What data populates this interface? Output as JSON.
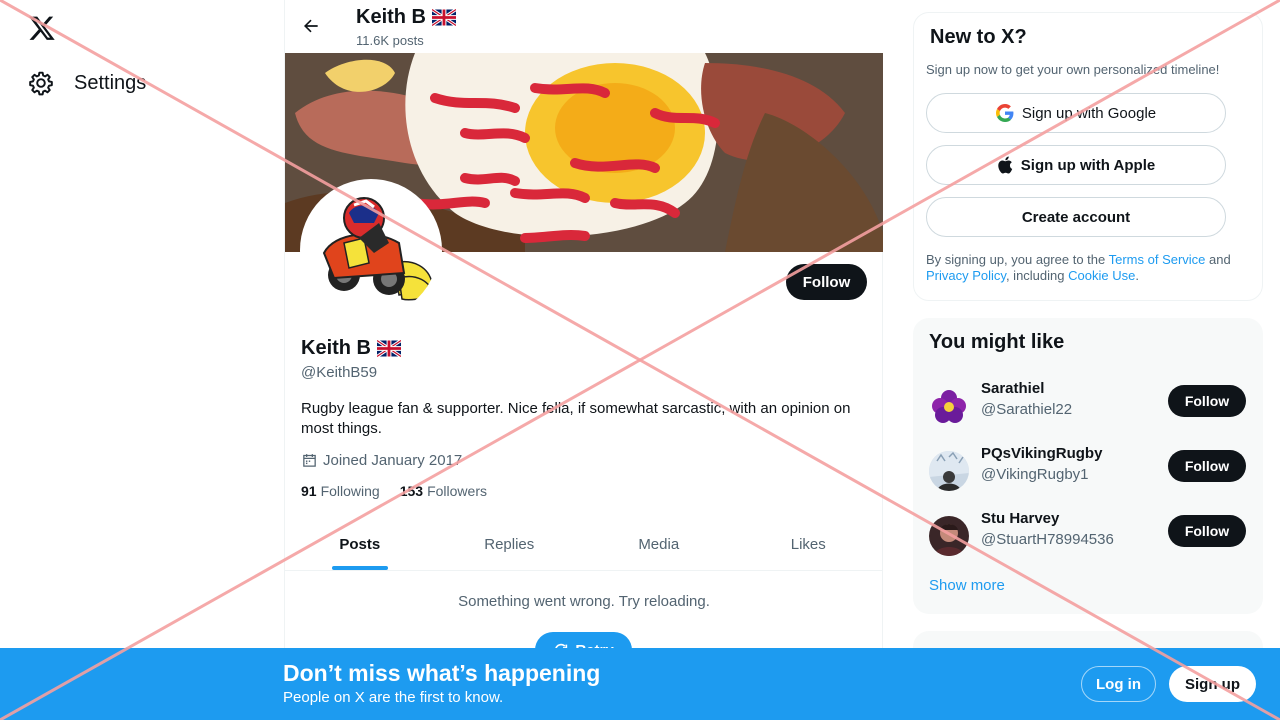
{
  "nav": {
    "logo_icon": "x-logo-icon",
    "settings_label": "Settings"
  },
  "header": {
    "name": "Keith B",
    "posts_count": "11.6K posts"
  },
  "profile": {
    "name": "Keith B",
    "handle": "@KeithB59",
    "bio": "Rugby league fan & supporter. Nice fella, if somewhat sarcastic, with an opinion on most things.",
    "joined": "Joined January 2017",
    "following_count": "91",
    "following_label": "Following",
    "followers_count": "153",
    "followers_label": "Followers",
    "follow_label": "Follow"
  },
  "tabs": [
    {
      "label": "Posts",
      "active": true
    },
    {
      "label": "Replies",
      "active": false
    },
    {
      "label": "Media",
      "active": false
    },
    {
      "label": "Likes",
      "active": false
    }
  ],
  "feed": {
    "error_message": "Something went wrong. Try reloading.",
    "retry_label": "Retry"
  },
  "signup_card": {
    "title": "New to X?",
    "subtitle": "Sign up now to get your own personalized timeline!",
    "google_label": "Sign up with Google",
    "apple_label": "Sign up with Apple",
    "create_label": "Create account",
    "legal_prefix": "By signing up, you agree to the ",
    "terms_link": "Terms of Service",
    "legal_and": " and ",
    "privacy_link": "Privacy Policy",
    "legal_including": ", including ",
    "cookie_link": "Cookie Use",
    "legal_suffix": "."
  },
  "suggestions": {
    "title": "You might like",
    "items": [
      {
        "name": "Sarathiel",
        "handle": "@Sarathiel22",
        "follow_label": "Follow"
      },
      {
        "name": "PQsVikingRugby",
        "handle": "@VikingRugby1",
        "follow_label": "Follow"
      },
      {
        "name": "Stu Harvey",
        "handle": "@StuartH78994536",
        "follow_label": "Follow"
      }
    ],
    "show_more": "Show more"
  },
  "bottom_bar": {
    "title": "Don’t miss what’s happening",
    "subtitle": "People on X are the first to know.",
    "login_label": "Log in",
    "signup_label": "Sign up"
  },
  "colors": {
    "accent": "#1d9bf0",
    "text": "#0f1419",
    "muted": "#536471",
    "overlay_cross": "#f4a0a0"
  }
}
